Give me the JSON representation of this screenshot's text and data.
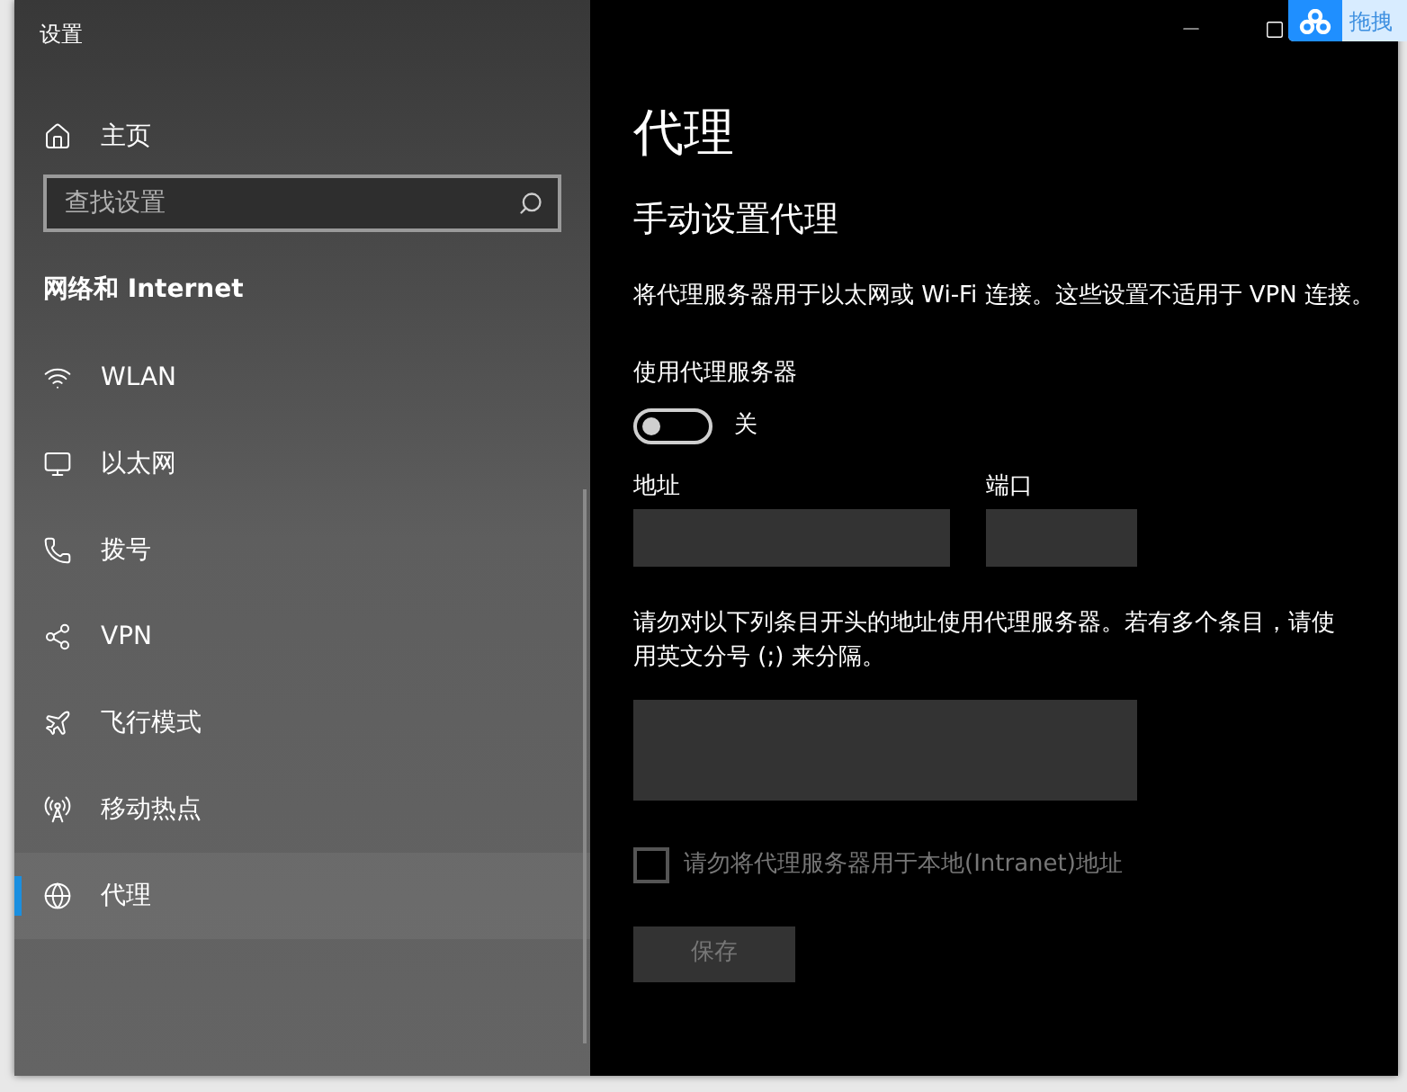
{
  "window": {
    "title": "设置"
  },
  "badge": {
    "text": "拖拽"
  },
  "sidebar": {
    "home": "主页",
    "search": {
      "placeholder": "查找设置"
    },
    "heading": "网络和 Internet",
    "items": [
      {
        "label": "WLAN",
        "selected": false
      },
      {
        "label": "以太网",
        "selected": false
      },
      {
        "label": "拨号",
        "selected": false
      },
      {
        "label": "VPN",
        "selected": false
      },
      {
        "label": "飞行模式",
        "selected": false
      },
      {
        "label": "移动热点",
        "selected": false
      },
      {
        "label": "代理",
        "selected": true
      }
    ]
  },
  "page": {
    "title": "代理",
    "section": "手动设置代理",
    "description": "将代理服务器用于以太网或 Wi-Fi 连接。这些设置不适用于 VPN 连接。",
    "toggle": {
      "label": "使用代理服务器",
      "on": false,
      "state_text": "关"
    },
    "address": {
      "label": "地址"
    },
    "port": {
      "label": "端口"
    },
    "exceptions": {
      "text": "请勿对以下列条目开头的地址使用代理服务器。若有多个条目，请使用英文分号 (;) 来分隔。"
    },
    "local_checkbox": {
      "label": "请勿将代理服务器用于本地(Intranet)地址",
      "checked": false,
      "disabled": true
    },
    "save": {
      "label": "保存",
      "disabled": true
    }
  }
}
